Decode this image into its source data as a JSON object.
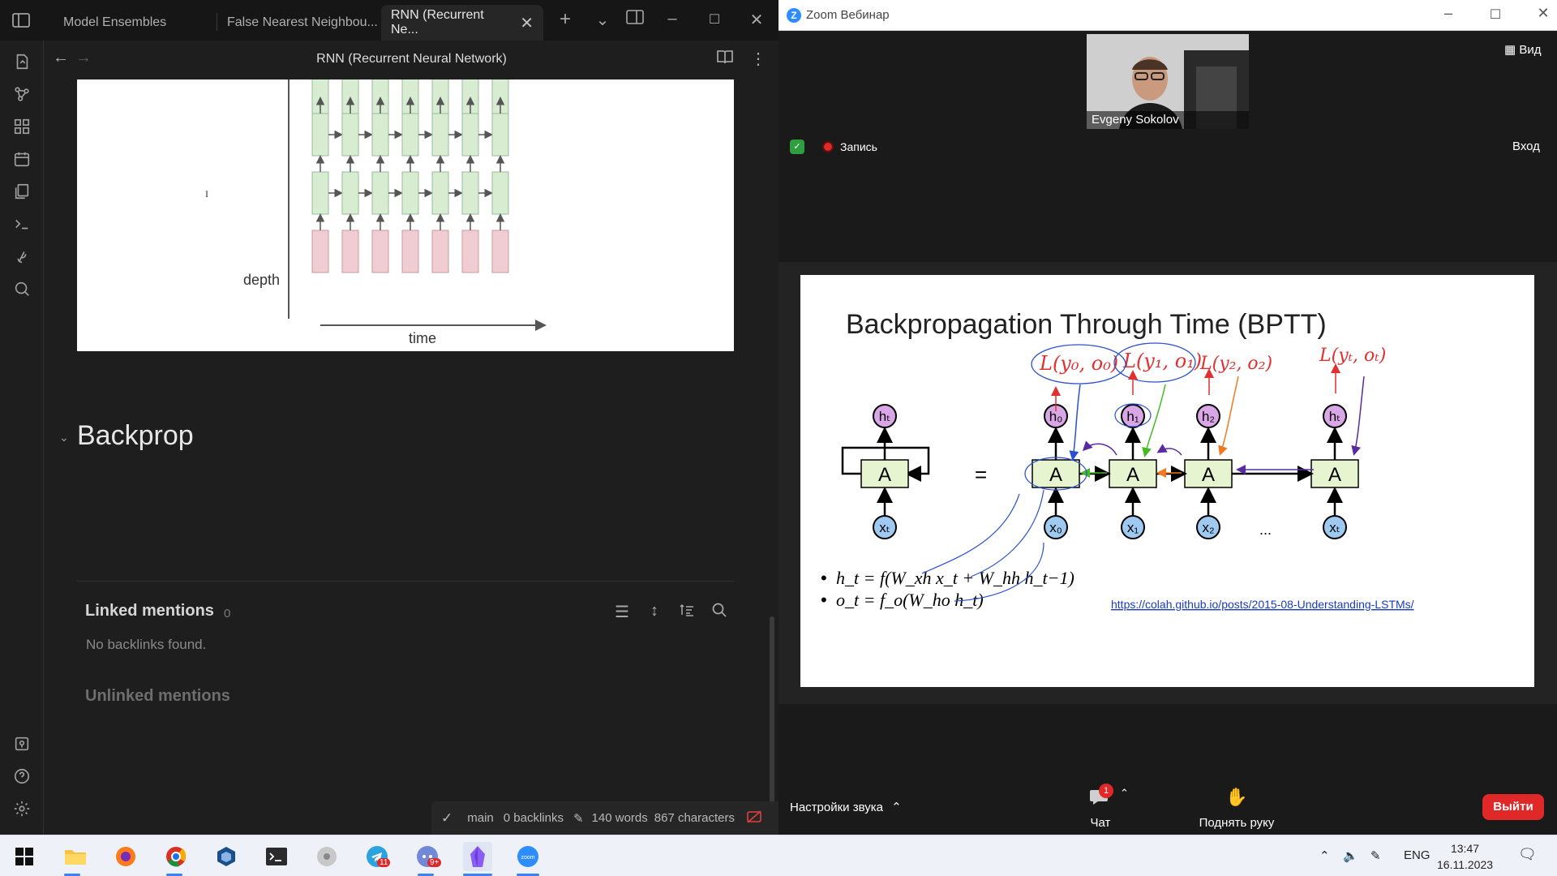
{
  "obsidian": {
    "tabs": [
      {
        "label": "Model Ensembles"
      },
      {
        "label": "False Nearest Neighbou..."
      },
      {
        "label": "RNN (Recurrent Ne..."
      }
    ],
    "close_glyph": "✕",
    "note_title": "RNN (Recurrent Neural Network)",
    "figure": {
      "depth_label": "depth",
      "time_label": "time",
      "cursor_glyph": "I"
    },
    "heading": "Backprop",
    "linked_mentions": {
      "title": "Linked mentions",
      "count": "0",
      "empty": "No backlinks found."
    },
    "unlinked_mentions": "Unlinked mentions",
    "status": {
      "branch": "main",
      "backlinks": "0 backlinks",
      "words": "140 words",
      "characters": "867 characters"
    }
  },
  "zoom": {
    "window_title": "Zoom Вебинар",
    "participant_name": "Evgeny Sokolov",
    "view_label": "Вид",
    "recording_label": "Запись",
    "enter_label": "Вход",
    "slide": {
      "title": "Backpropagation Through Time (BPTT)",
      "cell_label": "A",
      "equals": "=",
      "ellipsis": "...",
      "equation_1": "h_t = f(W_xh x_t + W_hh h_t−1)",
      "equation_2": "o_t = f_o(W_ho h_t)",
      "link": "https://colah.github.io/posts/2015-08-Understanding-LSTMs/",
      "handwritten_losses": [
        "L(y₀, o₀)",
        "L(y₁, o₁)",
        "L(y₂, o₂)",
        "L(yₜ, oₜ)"
      ],
      "hidden_labels": [
        "hₜ",
        "h₀",
        "h₁",
        "h₂",
        "hₜ"
      ],
      "input_labels": [
        "xₜ",
        "x₀",
        "x₁",
        "x₂",
        "xₜ"
      ]
    },
    "sound_settings": "Настройки звука",
    "chat_label": "Чат",
    "chat_badge": "1",
    "raise_hand": "Поднять руку",
    "leave": "Выйти"
  },
  "taskbar": {
    "lang": "ENG",
    "time": "13:47",
    "date": "16.11.2023",
    "telegram_badge": "11",
    "discord_badge": "9+"
  },
  "colors": {
    "obsidian_bg": "#1e1e1e",
    "zoom_red": "#e02828",
    "slide_cell_fill": "#e6f5d0",
    "hidden_fill": "#d9a6e6",
    "input_fill": "#9ec9f0"
  }
}
